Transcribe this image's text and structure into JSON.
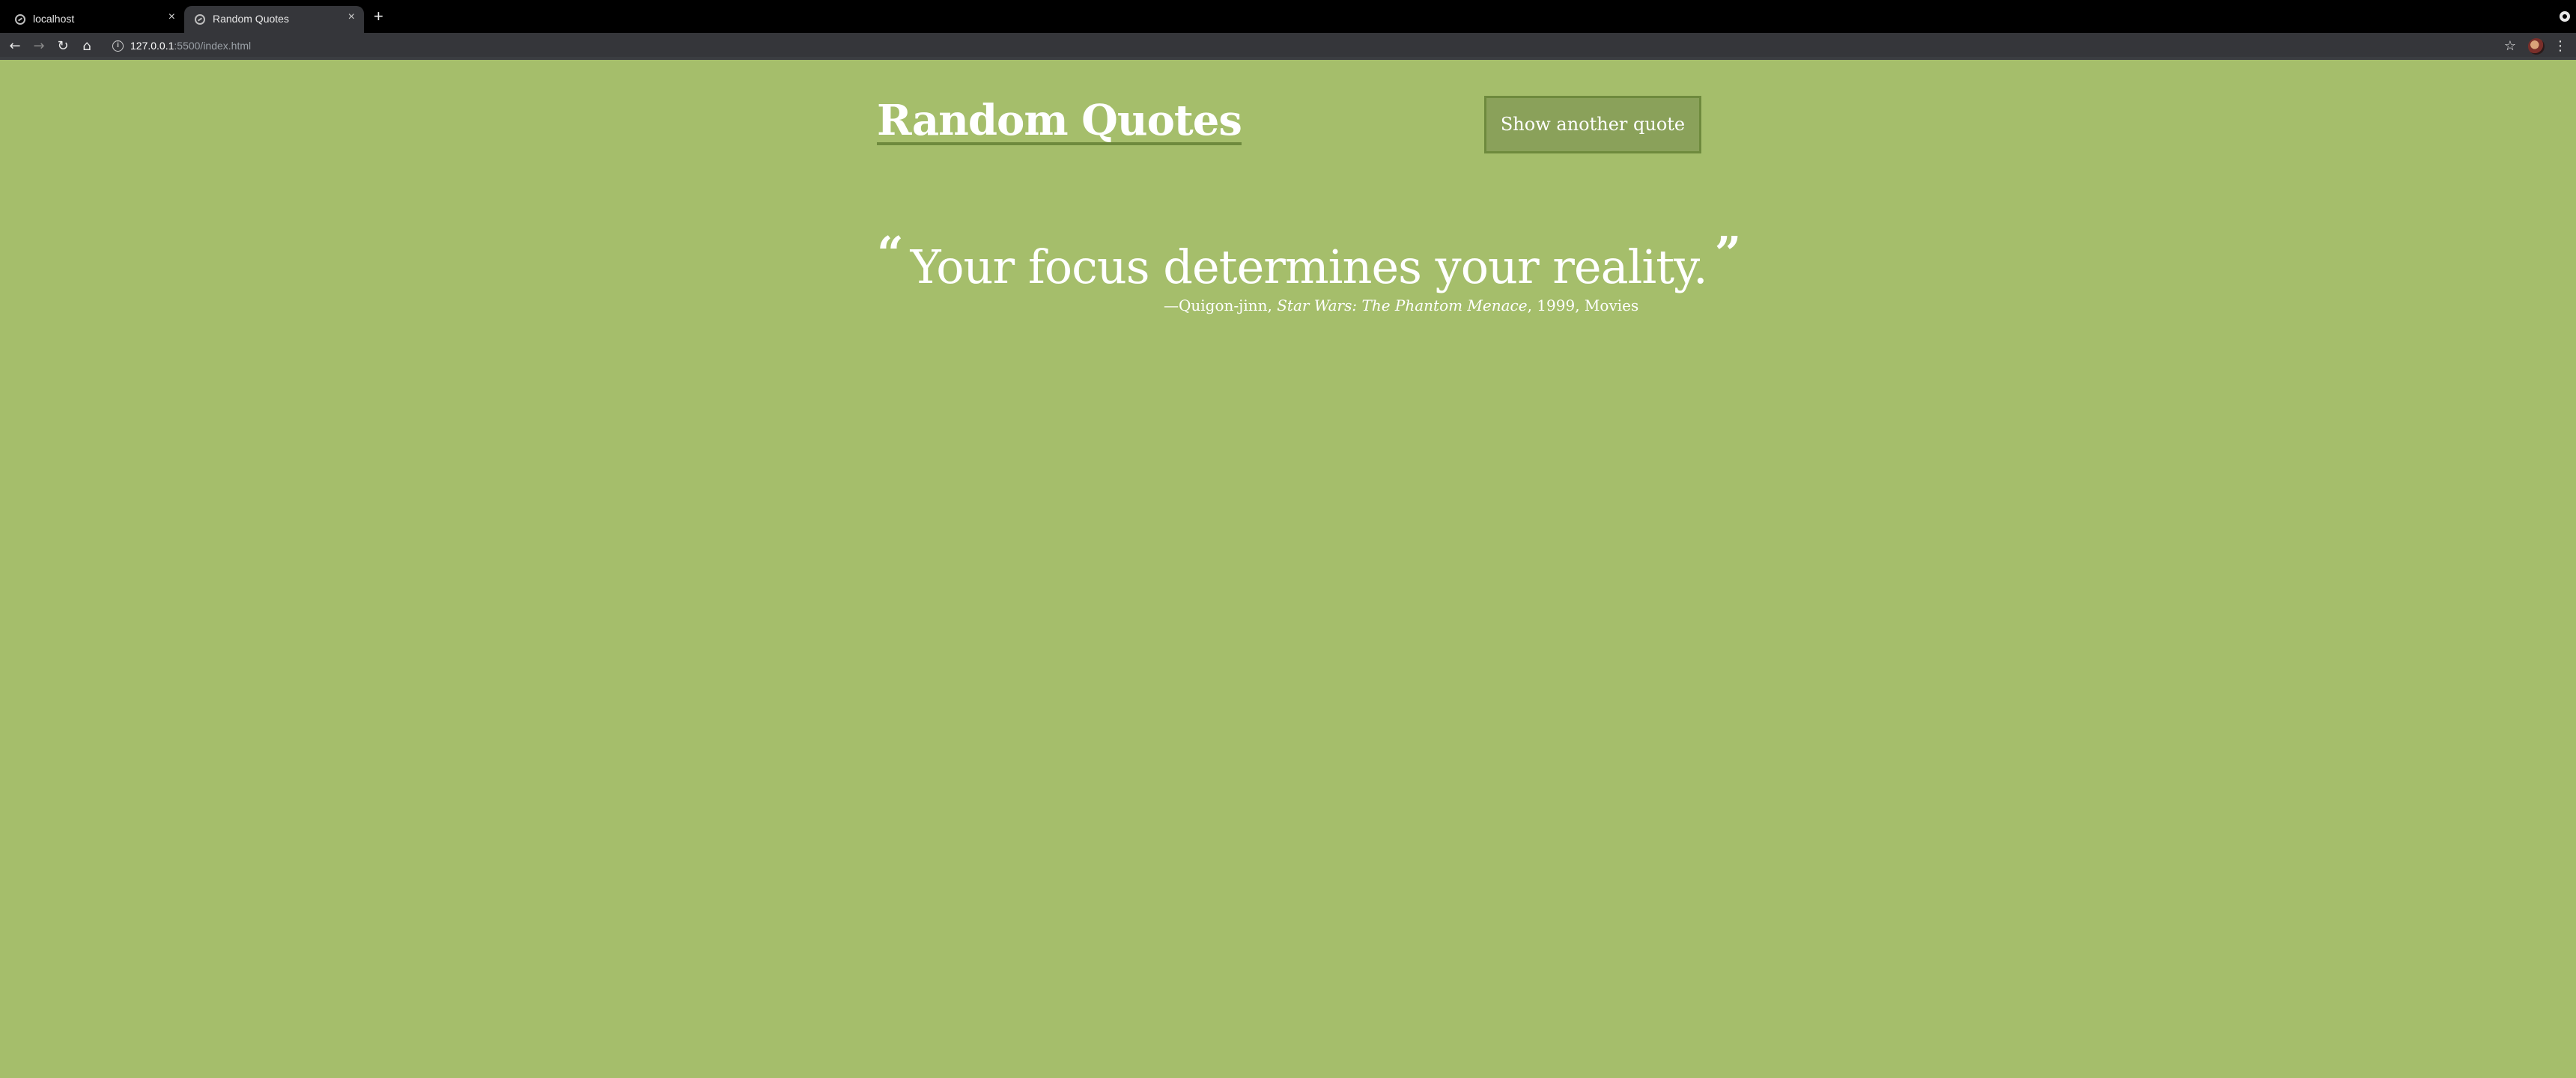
{
  "browser": {
    "tabs": [
      {
        "title": "localhost",
        "active": false
      },
      {
        "title": "Random Quotes",
        "active": true
      }
    ],
    "url_host": "127.0.0.1",
    "url_rest": ":5500/index.html",
    "icons": {
      "back": "back-arrow-icon",
      "forward": "forward-arrow-icon",
      "reload": "reload-icon",
      "home": "home-icon",
      "info": "info-icon",
      "bookmark": "star-icon",
      "menu": "kebab-menu-icon"
    }
  },
  "page": {
    "title": "Random Quotes",
    "button_label": "Show another quote",
    "quote_text": "Your focus determines your reality.",
    "open_mark": "“",
    "close_mark": "”",
    "citation_prefix": "—Quigon-jinn, ",
    "citation_source": "Star Wars: The Phantom Menace",
    "citation_suffix": ", 1999, Movies",
    "colors": {
      "background": "#a5be6b",
      "button_bg": "#8aa15a",
      "accent": "#6e8a3d",
      "text": "#ffffff"
    }
  }
}
